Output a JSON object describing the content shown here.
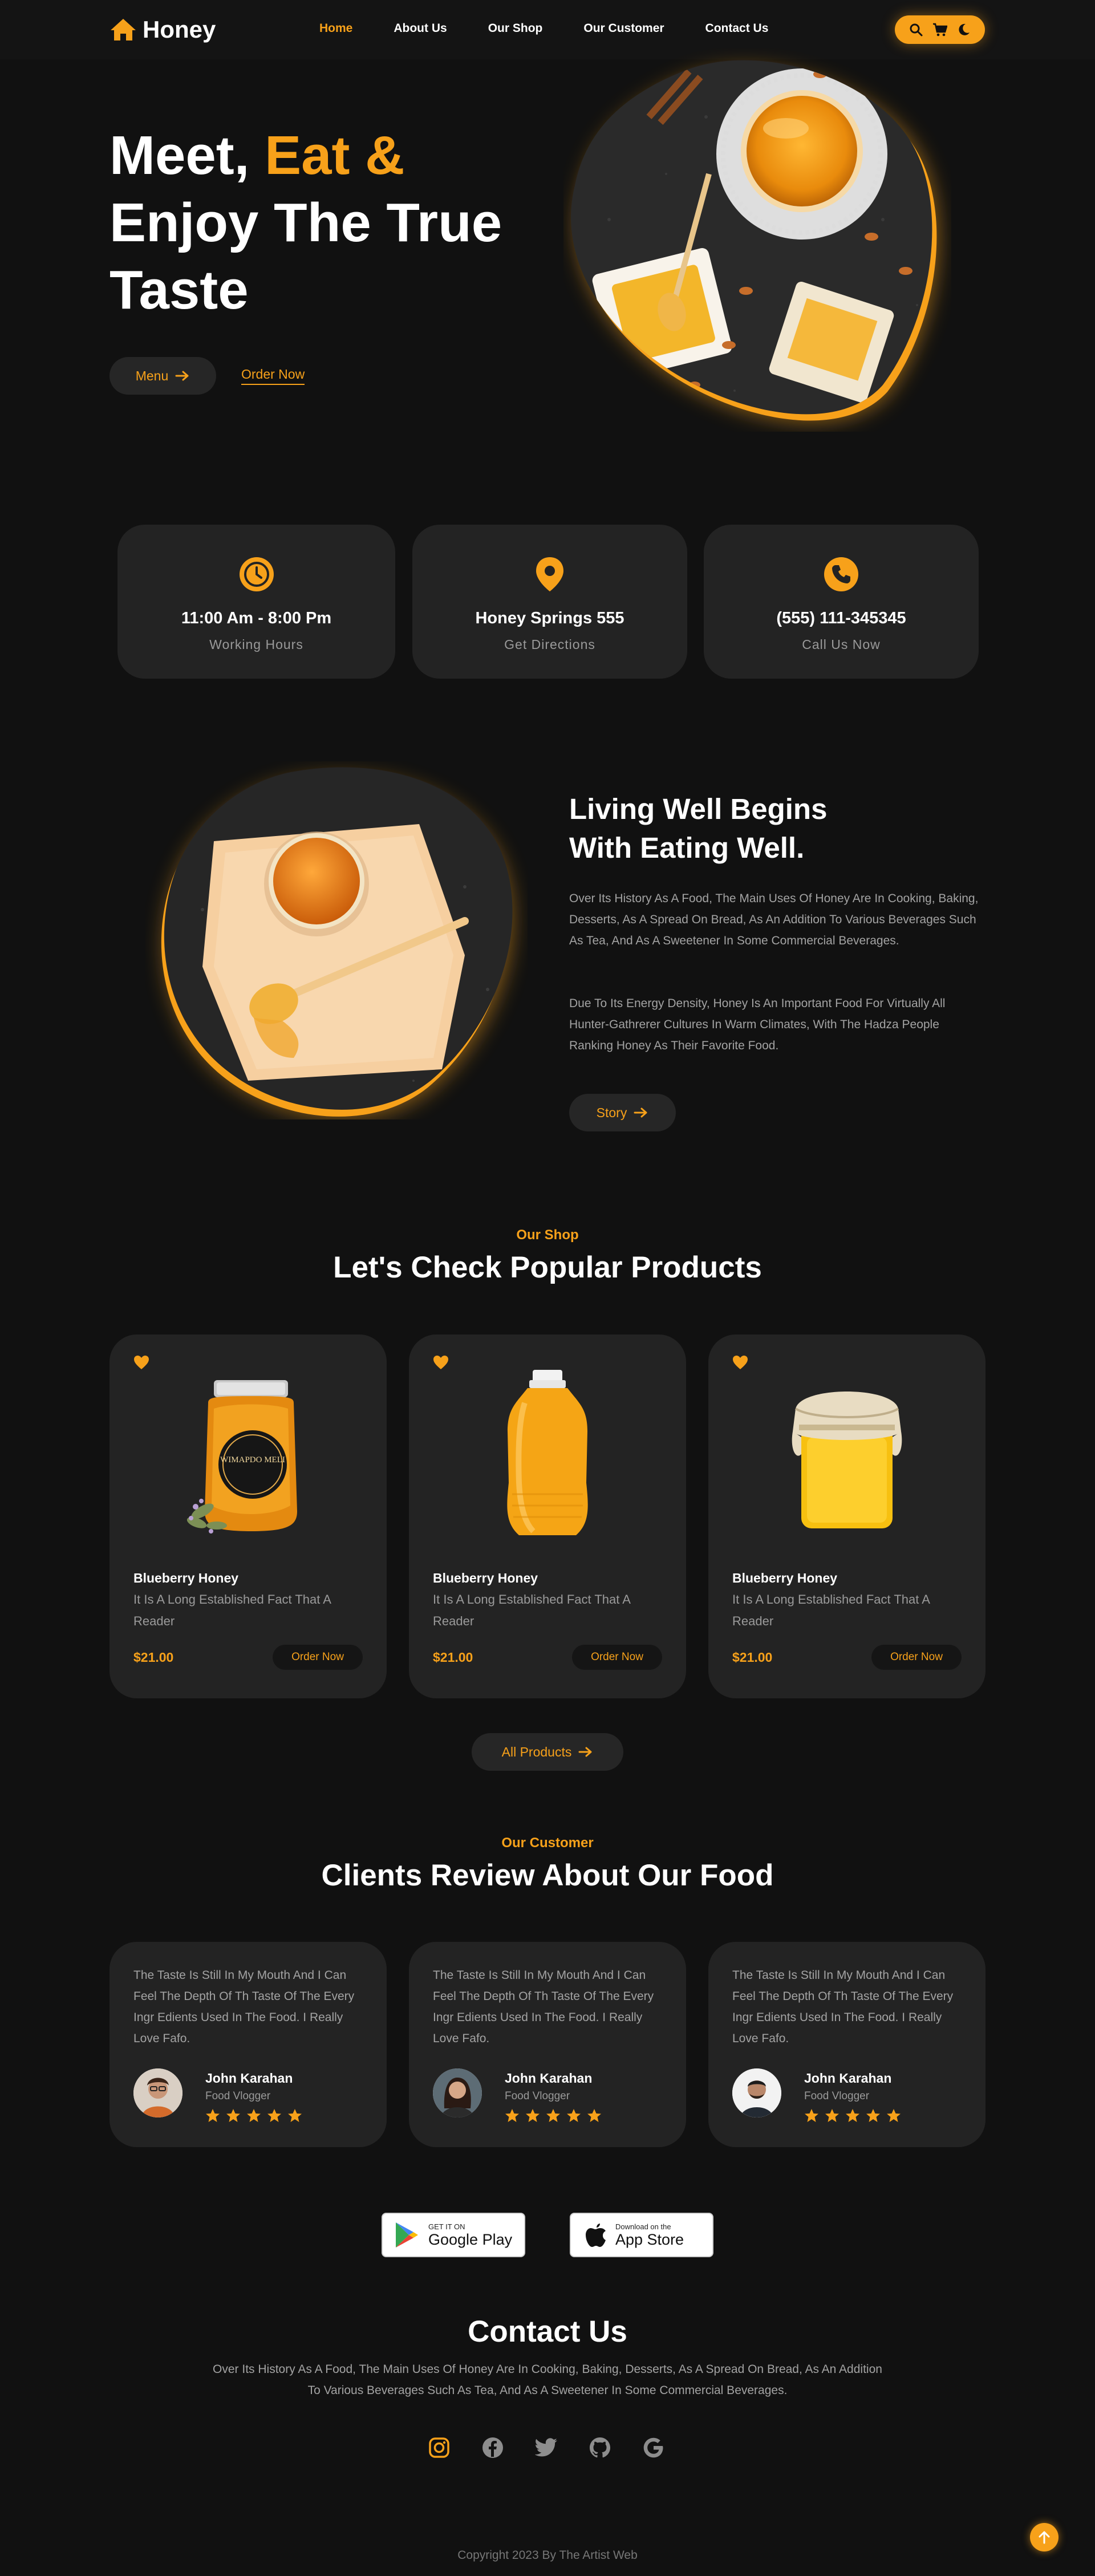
{
  "header": {
    "logo_text": "Honey",
    "nav": [
      "Home",
      "About Us",
      "Our Shop",
      "Our Customer",
      "Contact Us"
    ],
    "active_nav": "Home",
    "tools": [
      "search-icon",
      "cart-icon",
      "moon-icon"
    ]
  },
  "hero": {
    "title_part1": "Meet, ",
    "title_part2": "Eat &",
    "title_part3": "Enjoy The True Taste",
    "menu_button": "Menu",
    "order_link": "Order Now"
  },
  "info": [
    {
      "icon": "clock-icon",
      "title": "11:00 Am - 8:00 Pm",
      "sub": "Working Hours"
    },
    {
      "icon": "location-pin-icon",
      "title": "Honey Springs 555",
      "sub": "Get Directions"
    },
    {
      "icon": "phone-icon",
      "title": "(555) 111-345345",
      "sub": "Call Us Now"
    }
  ],
  "about": {
    "title_line1": "Living Well Begins",
    "title_line2": "With Eating Well.",
    "para1": "Over Its History As A Food, The Main Uses Of Honey Are In Cooking, Baking, Desserts, As A Spread On Bread, As An Addition To Various Beverages Such As Tea, And As A Sweetener In Some Commercial Beverages.",
    "para2": "Due To Its Energy Density, Honey Is An Important Food For Virtually All Hunter-Gathrerer Cultures In Warm Climates, With The Hadza People Ranking Honey As Their Favorite Food.",
    "button": "Story"
  },
  "shop": {
    "kicker": "Our Shop",
    "title": "Let's Check Popular Products",
    "products": [
      {
        "name": "Blueberry Honey",
        "desc": "It Is A Long Established Fact That A Reader",
        "price": "$21.00",
        "button": "Order Now",
        "label": "WIMAPDO MELI"
      },
      {
        "name": "Blueberry Honey",
        "desc": "It Is A Long Established Fact That A Reader",
        "price": "$21.00",
        "button": "Order Now"
      },
      {
        "name": "Blueberry Honey",
        "desc": "It Is A Long Established Fact That A Reader",
        "price": "$21.00",
        "button": "Order Now"
      }
    ],
    "all_button": "All Products"
  },
  "reviews": {
    "kicker": "Our Customer",
    "title": "Clients Review About Our Food",
    "items": [
      {
        "text": "The Taste Is Still In My Mouth And I Can Feel The Depth Of Th Taste Of The Every Ingr Edients Used In The Food. I Really Love Fafo.",
        "name": "John Karahan",
        "role": "Food Vlogger",
        "rating": 5
      },
      {
        "text": "The Taste Is Still In My Mouth And I Can Feel The Depth Of Th Taste Of The Every Ingr Edients Used In The Food. I Really Love Fafo.",
        "name": "John Karahan",
        "role": "Food Vlogger",
        "rating": 5
      },
      {
        "text": "The Taste Is Still In My Mouth And I Can Feel The Depth Of Th Taste Of The Every Ingr Edients Used In The Food. I Really Love Fafo.",
        "name": "John Karahan",
        "role": "Food Vlogger",
        "rating": 5
      }
    ]
  },
  "stores": {
    "google_small": "GET IT ON",
    "google_big": "Google Play",
    "apple_small": "Download on the",
    "apple_big": "App Store"
  },
  "contact": {
    "title": "Contact Us",
    "text": "Over Its History As A Food, The Main Uses Of Honey Are In Cooking, Baking, Desserts, As A Spread On Bread, As An Addition To Various Beverages Such As Tea, And As A Sweetener In Some Commercial Beverages.",
    "social": [
      "instagram-icon",
      "facebook-icon",
      "twitter-icon",
      "github-icon",
      "google-icon"
    ]
  },
  "footer": {
    "copyright": "Copyright 2023 By The Artist Web"
  },
  "colors": {
    "accent": "#f7a11a",
    "background": "#111111",
    "card": "#232323"
  }
}
